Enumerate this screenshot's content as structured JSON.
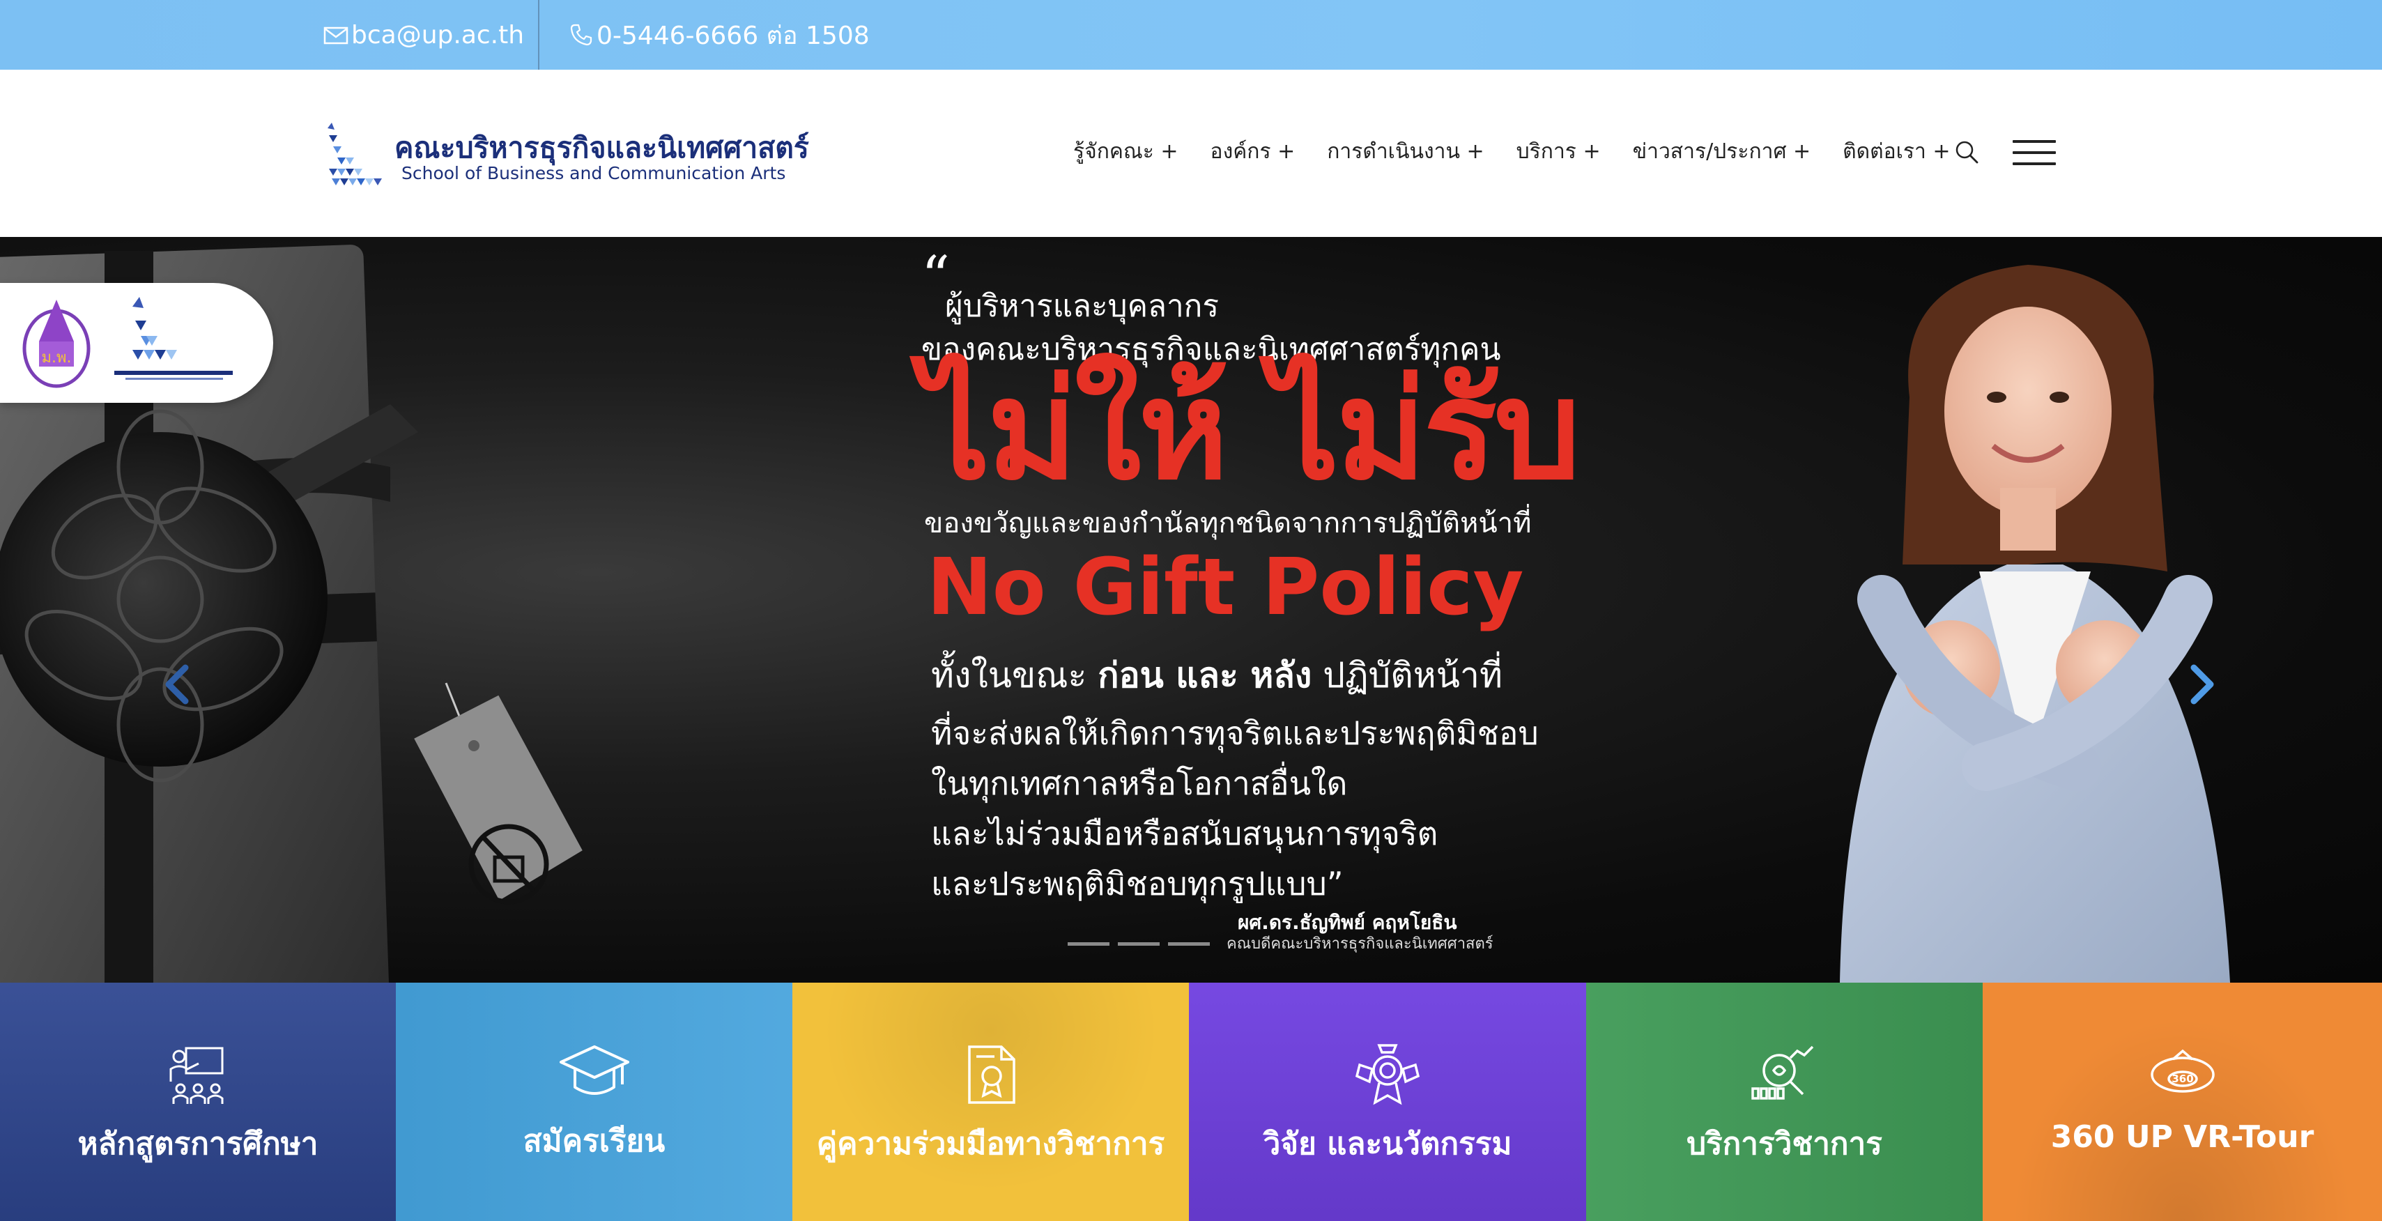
{
  "topbar": {
    "email": "bca@up.ac.th",
    "phone": "0-5446-6666 ต่อ 1508"
  },
  "header": {
    "logo_title": "คณะบริหารธุรกิจและนิเทศศาสตร์",
    "logo_subtitle": "School of Business and Communication Arts",
    "nav": [
      {
        "label": "รู้จักคณะ +"
      },
      {
        "label": "องค์กร +"
      },
      {
        "label": "การดำเนินงาน +"
      },
      {
        "label": "บริการ +"
      },
      {
        "label": "ข่าวสาร/ประกาศ +"
      },
      {
        "label": "ติดต่อเรา +"
      }
    ],
    "icons": {
      "search": "search-icon",
      "menu": "hamburger-menu-icon"
    }
  },
  "hero": {
    "line1": "ผู้บริหารและบุคลากร",
    "line2": "ของคณะบริหารธุรกิจและนิเทศศาสตร์ทุกคน",
    "headline": "ไม่ให้ ไม่รับ",
    "line3": "ของขวัญและของกำนัลทุกชนิดจากการปฏิบัติหน้าที่",
    "policy": "No Gift Policy",
    "line4_a": "ทั้งในขณะ ",
    "line4_b": "ก่อน และ หลัง",
    "line4_c": " ปฏิบัติหน้าที่",
    "line5": "ที่จะส่งผลให้เกิดการทุจริตและประพฤติมิชอบ",
    "line6": "ในทุกเทศกาลหรือโอกาสอื่นใด",
    "line7": "และไม่ร่วมมือหรือสนับสนุนการทุจริต",
    "line8": "และประพฤติมิชอบทุกรูปแบบ”",
    "signature_name": "ผศ.ดร.ธัญทิพย์ คฤหโยธิน",
    "signature_role": "คณบดีคณะบริหารธุรกิจและนิเทศศาสตร์",
    "slides_count": 3,
    "accent_color": "#e63125"
  },
  "tiles": [
    {
      "label": "หลักสูตรการศึกษา",
      "color": "#2e4690",
      "icon": "teacher-board-icon"
    },
    {
      "label": "สมัครเรียน",
      "color": "#44a2dc",
      "icon": "graduation-cap-icon"
    },
    {
      "label": "คู่ความร่วมมือทางวิชาการ",
      "color": "#f2c13b",
      "icon": "certificate-document-icon"
    },
    {
      "label": "วิจัย และนวัตกรรม",
      "color": "#6f3fe0",
      "icon": "research-award-icon"
    },
    {
      "label": "บริการวิชาการ",
      "color": "#3f9a56",
      "icon": "analytics-search-icon"
    },
    {
      "label": "360 UP VR-Tour",
      "color": "#ef8a35",
      "icon": "vr-360-icon"
    }
  ]
}
